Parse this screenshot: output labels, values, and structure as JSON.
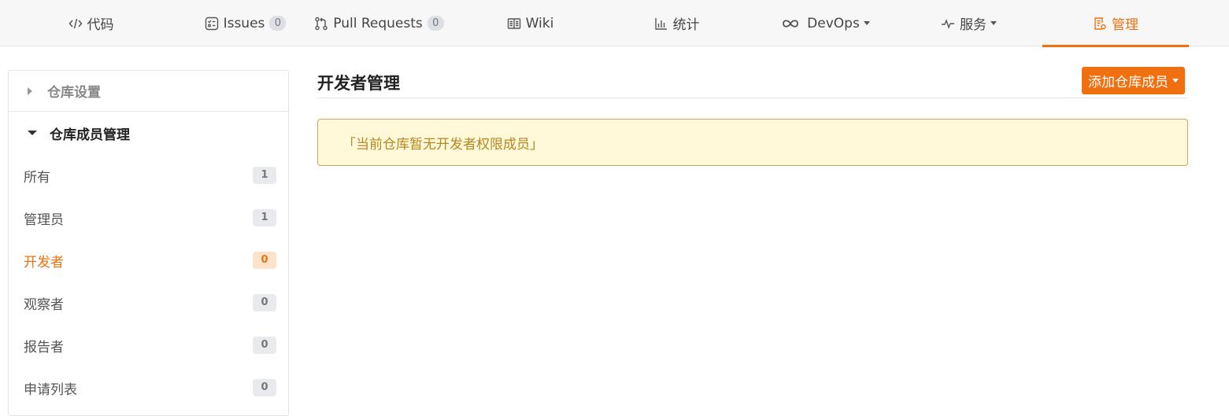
{
  "tabs": [
    {
      "id": "code",
      "label": "代码",
      "icon": "code-icon"
    },
    {
      "id": "issues",
      "label": "Issues",
      "count": "0",
      "icon": "issues-icon"
    },
    {
      "id": "pull-requests",
      "label": "Pull Requests",
      "count": "0",
      "icon": "pull-request-icon"
    },
    {
      "id": "wiki",
      "label": "Wiki",
      "icon": "book-icon"
    },
    {
      "id": "stats",
      "label": "统计",
      "icon": "bar-chart-icon"
    },
    {
      "id": "devops",
      "label": "DevOps",
      "icon": "infinity-icon",
      "dropdown": true
    },
    {
      "id": "services",
      "label": "服务",
      "icon": "pulse-icon",
      "dropdown": true
    },
    {
      "id": "manage",
      "label": "管理",
      "icon": "document-settings-icon",
      "active": true
    }
  ],
  "sidebar": {
    "repo_settings": "仓库设置",
    "members_section": "仓库成员管理",
    "items": [
      {
        "label": "所有",
        "count": "1"
      },
      {
        "label": "管理员",
        "count": "1"
      },
      {
        "label": "开发者",
        "count": "0",
        "active": true
      },
      {
        "label": "观察者",
        "count": "0"
      },
      {
        "label": "报告者",
        "count": "0"
      },
      {
        "label": "申请列表",
        "count": "0"
      }
    ]
  },
  "main": {
    "title": "开发者管理",
    "add_button": "添加仓库成员",
    "notice": "「当前仓库暂无开发者权限成员」"
  },
  "colors": {
    "accent": "#f0700f",
    "notice_bg": "#fff8d9",
    "notice_text": "#b6871f"
  }
}
